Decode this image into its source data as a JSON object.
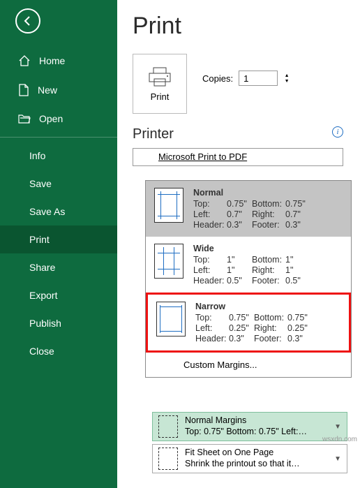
{
  "sidebar": {
    "items": [
      {
        "label": "Home"
      },
      {
        "label": "New"
      },
      {
        "label": "Open"
      },
      {
        "label": "Info"
      },
      {
        "label": "Save"
      },
      {
        "label": "Save As"
      },
      {
        "label": "Print"
      },
      {
        "label": "Share"
      },
      {
        "label": "Export"
      },
      {
        "label": "Publish"
      },
      {
        "label": "Close"
      }
    ]
  },
  "main": {
    "title": "Print",
    "print_btn": "Print",
    "copies_label": "Copies:",
    "copies_value": "1",
    "printer_heading": "Printer",
    "printer_name": "Microsoft Print to PDF"
  },
  "margins": {
    "options": [
      {
        "name": "Normal",
        "top_l": "Top:",
        "top_v": "0.75\"",
        "bottom_l": "Bottom:",
        "bottom_v": "0.75\"",
        "left_l": "Left:",
        "left_v": "0.7\"",
        "right_l": "Right:",
        "right_v": "0.7\"",
        "header_l": "Header:",
        "header_v": "0.3\"",
        "footer_l": "Footer:",
        "footer_v": "0.3\""
      },
      {
        "name": "Wide",
        "top_l": "Top:",
        "top_v": "1\"",
        "bottom_l": "Bottom:",
        "bottom_v": "1\"",
        "left_l": "Left:",
        "left_v": "1\"",
        "right_l": "Right:",
        "right_v": "1\"",
        "header_l": "Header:",
        "header_v": "0.5\"",
        "footer_l": "Footer:",
        "footer_v": "0.5\""
      },
      {
        "name": "Narrow",
        "top_l": "Top:",
        "top_v": "0.75\"",
        "bottom_l": "Bottom:",
        "bottom_v": "0.75\"",
        "left_l": "Left:",
        "left_v": "0.25\"",
        "right_l": "Right:",
        "right_v": "0.25\"",
        "header_l": "Header:",
        "header_v": "0.3\"",
        "footer_l": "Footer:",
        "footer_v": "0.3\""
      }
    ],
    "custom": "Custom Margins..."
  },
  "bottom": {
    "selected_title": "Normal Margins",
    "selected_sub": "Top: 0.75\" Bottom: 0.75\" Left:…",
    "fit_title": "Fit Sheet on One Page",
    "fit_sub": "Shrink the printout so that it…"
  },
  "watermark": "wsxdn.com"
}
